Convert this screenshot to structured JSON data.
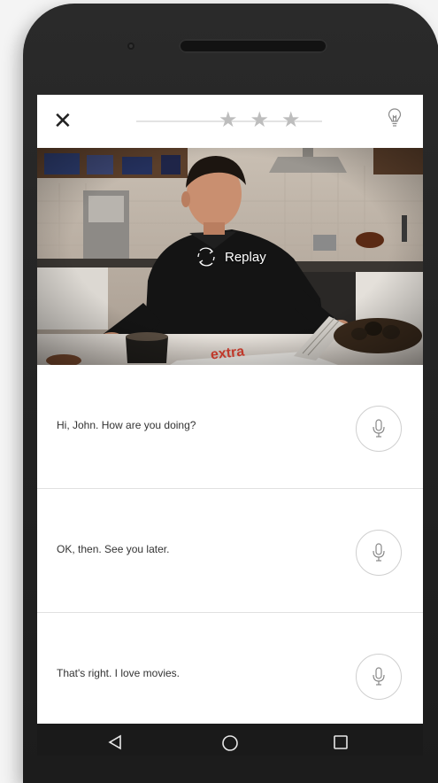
{
  "header": {
    "close_label": "✕",
    "stars": [
      "★",
      "★",
      "★"
    ]
  },
  "video": {
    "replay_label": "Replay",
    "mug_text": "extra"
  },
  "options": [
    {
      "text": "Hi, John. How are you doing?"
    },
    {
      "text": "OK, then. See you later."
    },
    {
      "text": "That's right. I love movies."
    }
  ],
  "colors": {
    "star": "#bdbdbd",
    "phone_body": "#1c1c1c",
    "divider": "#e1e1e1"
  },
  "icons": {
    "close": "close-icon",
    "hint": "lightbulb-icon",
    "replay": "replay-icon",
    "mic": "microphone-icon",
    "nav_back": "back-triangle-icon",
    "nav_home": "home-circle-icon",
    "nav_recents": "recents-square-icon"
  }
}
